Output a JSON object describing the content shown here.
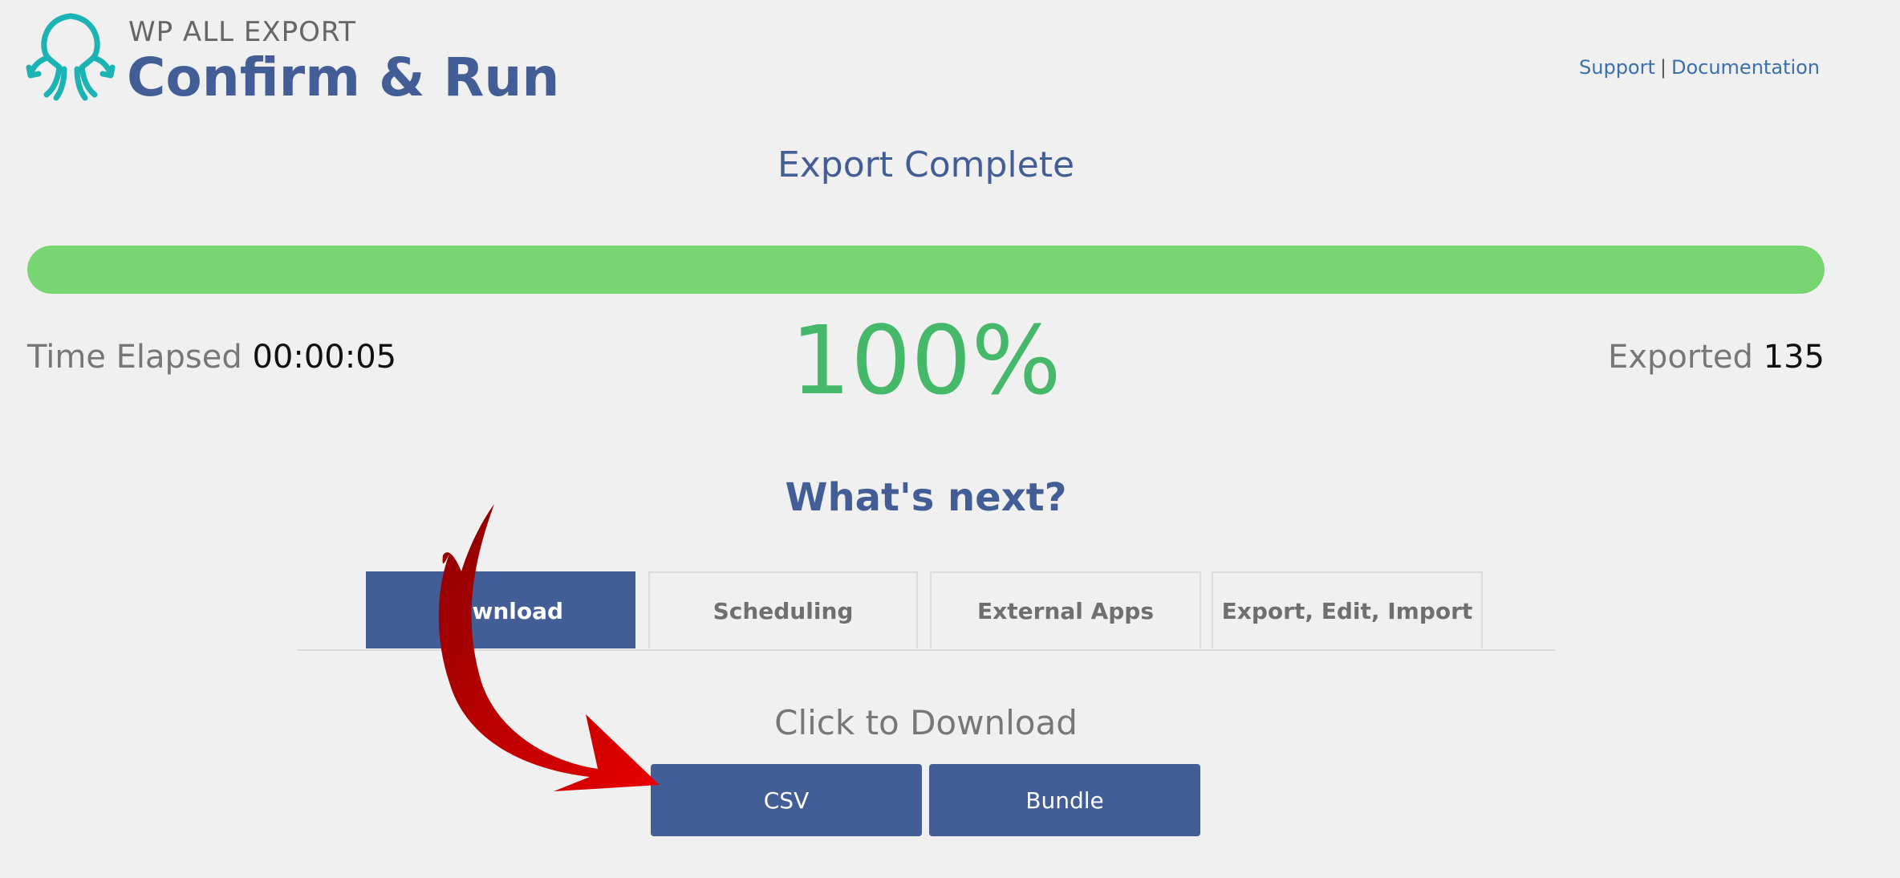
{
  "header": {
    "brand_small": "WP ALL EXPORT",
    "title": "Confirm & Run",
    "links": {
      "support": "Support",
      "separator": "|",
      "documentation": "Documentation"
    }
  },
  "status": {
    "title": "Export Complete",
    "progress_percent": 100,
    "percent_text": "100%",
    "time_elapsed_label": "Time Elapsed",
    "time_elapsed_value": "00:00:05",
    "exported_label": "Exported",
    "exported_value": "135"
  },
  "next": {
    "heading": "What's next?",
    "tabs": [
      {
        "label": "Download",
        "active": true
      },
      {
        "label": "Scheduling",
        "active": false
      },
      {
        "label": "External Apps",
        "active": false
      },
      {
        "label": "Export, Edit, Import",
        "active": false
      }
    ]
  },
  "download": {
    "heading": "Click to Download",
    "buttons": {
      "csv": "CSV",
      "bundle": "Bundle"
    }
  },
  "colors": {
    "brand_blue": "#435e97",
    "progress_green": "#78d672",
    "percent_green": "#45b86a",
    "logo_teal": "#1bb3b3",
    "annotation_red": "#c40000"
  },
  "icons": {
    "logo": "octopus-logo-icon",
    "annotation": "curved-arrow-icon"
  }
}
